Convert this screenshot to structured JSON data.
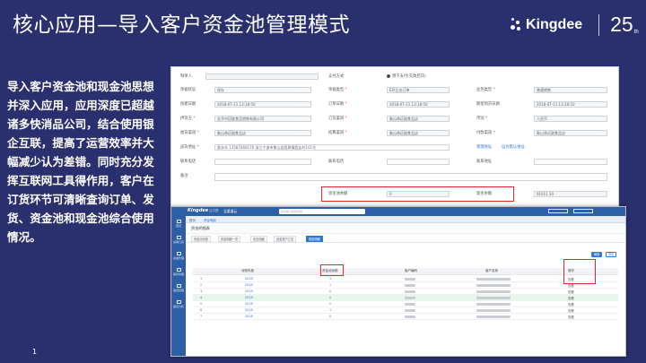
{
  "slide": {
    "title": "核心应用—导入客户资金池管理模式",
    "description": "导入客户资金池和现金池思想并深入应用，应用深度已超越诸多快消品公司，结合使用银企互联，提高了运营效率并大幅减少认为差错。同时充分发挥互联网工具得作用，客户在订货环节可清晰查询订单、发货、资金池和现金池综合使用情况。",
    "page_number": "1"
  },
  "logo": {
    "brand": "Kingdee",
    "anniversary": "25",
    "sup": "th"
  },
  "form": {
    "row1": {
      "l1": "制单人",
      "l2": "支付方式",
      "radio": "预下支付(先款后货)"
    },
    "row2": {
      "l1": "单据状态",
      "v1": "保存",
      "l2": "单据类型",
      "v2": "E环企业订单",
      "l3": "业务类型",
      "v3": "普通销售"
    },
    "row3": {
      "l1": "创建日期",
      "v1": "2018-07-11 13:18:50",
      "l2": "订单日期",
      "v2": "2018-07-11 13:18:50",
      "l3": "期望到货日期",
      "v3": "2018-07-11 13:18:50"
    },
    "row4": {
      "l1": "供货方",
      "v1": "金华市回旋食品销售有限公司",
      "l2": "订货渠道",
      "v2": "象山承远副食品店",
      "l3": "币别",
      "v3": "人民币"
    },
    "row5": {
      "l1": "收货渠道",
      "v1": "象山承远副食品店",
      "l2": "结算渠道",
      "v2": "象山承远副食品店",
      "l3": "付款渠道",
      "v3": "象山承远副食品店"
    },
    "row6": {
      "l1": "送货地址",
      "v1": "夏永丰 13567468176  浙江宁波市象山县西周镇西店村101号",
      "link1": "管理地址",
      "link2": "设为默认地址"
    },
    "row7": {
      "l1": "联系电话",
      "l2": "联系电话",
      "l3": "联系地址"
    },
    "row8": {
      "l1": "备注"
    },
    "row9": {
      "l1": "资金池余额",
      "v1": "0",
      "l2": "现金余额",
      "v2": "91011.34"
    }
  },
  "list": {
    "brand": "Kingdee",
    "app_name": "云订货",
    "system": "全渠道云",
    "search_placeholder": "在此输入搜索内容",
    "sidebar": [
      "首页",
      "采购订货",
      "资金管理",
      "库存管理",
      "发货管理",
      "报表分析"
    ],
    "tabs": [
      "首页",
      "资金明细"
    ],
    "title": "资金明细表",
    "sub_tabs": [
      "资金池余额",
      "资金明细一览",
      "收支明细",
      "资金账户汇总",
      "现金明细"
    ],
    "buttons": [
      "刷新",
      "导出"
    ],
    "columns": [
      "",
      "对账年度",
      "资金池余额",
      "客户编码",
      "客户名称",
      "操作"
    ],
    "rows": [
      {
        "no": "1",
        "year": "2018",
        "pool": "3",
        "op": "查看"
      },
      {
        "no": "2",
        "year": "2018",
        "pool": "1",
        "op": "查看"
      },
      {
        "no": "3",
        "year": "2018",
        "pool": "0",
        "op": "查看"
      },
      {
        "no": "4",
        "year": "2018",
        "pool": "0",
        "op": "查看"
      },
      {
        "no": "5",
        "year": "2018",
        "pool": "0",
        "op": "查看"
      },
      {
        "no": "6",
        "year": "2018",
        "pool": "1",
        "op": "查看"
      },
      {
        "no": "7",
        "year": "2018",
        "pool": "0",
        "op": "查看"
      }
    ]
  },
  "colors": {
    "background": "#2a2f6d",
    "highlight": "#e0292e",
    "kingdee_blue": "#2d5fa6"
  }
}
